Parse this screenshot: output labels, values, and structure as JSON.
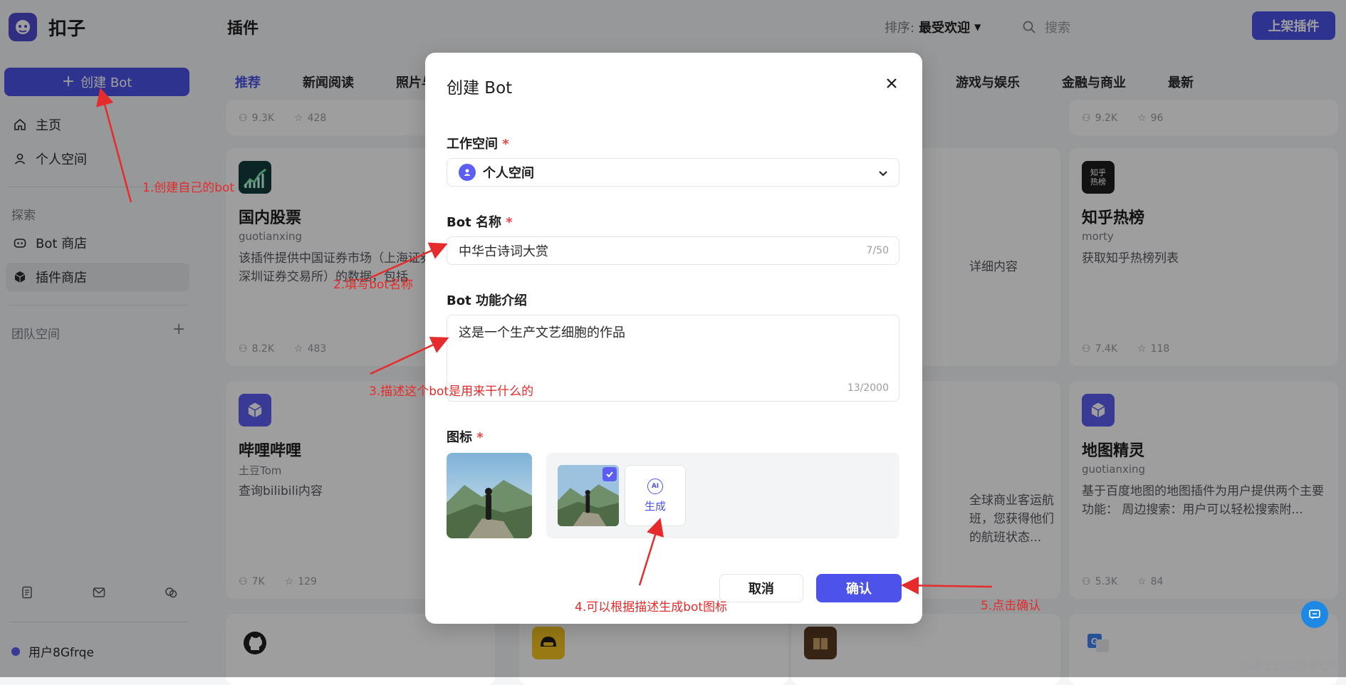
{
  "app": {
    "name": "扣子"
  },
  "sidebar": {
    "create_bot_label": "创建 Bot",
    "items": [
      {
        "label": "主页",
        "icon": "home-icon"
      },
      {
        "label": "个人空间",
        "icon": "user-icon"
      }
    ],
    "explore_label": "探索",
    "explore_items": [
      {
        "label": "Bot 商店",
        "icon": "bot-icon"
      },
      {
        "label": "插件商店",
        "icon": "cube-icon"
      }
    ],
    "team_label": "团队空间",
    "user_name": "用户8Gfrqe"
  },
  "header": {
    "title": "插件",
    "sort_label": "排序:",
    "sort_value": "最受欢迎",
    "search_placeholder": "搜索",
    "publish_label": "上架插件"
  },
  "categories": [
    "推荐",
    "新闻阅读",
    "照片与",
    "游戏与娱乐",
    "金融与商业",
    "最新"
  ],
  "cards": [
    {
      "title": "",
      "author": "",
      "desc": "",
      "uses": "9.3K",
      "stars": "428"
    },
    {
      "title": "",
      "author": "",
      "desc": "",
      "uses": "9.2K",
      "stars": "96"
    },
    {
      "title": "国内股票",
      "author": "guotianxing",
      "desc": "该插件提供中国证券市场（上海证券交易所和深圳证券交易所）的数据，包括",
      "uses": "8.2K",
      "stars": "483"
    },
    {
      "title": "",
      "author": "",
      "desc": "详细内容",
      "uses": "",
      "stars": ""
    },
    {
      "title": "知乎热榜",
      "author": "morty",
      "desc": "获取知乎热榜列表",
      "uses": "7.4K",
      "stars": "118",
      "icon_text": "知乎热榜"
    },
    {
      "title": "哔哩哔哩",
      "author": "土豆Tom",
      "desc": "查询bilibili内容",
      "uses": "7K",
      "stars": "129"
    },
    {
      "title": "",
      "author": "",
      "desc": "全球商业客运航班，您获得他们的航班状态...",
      "uses": "",
      "stars": ""
    },
    {
      "title": "地图精灵",
      "author": "guotianxing",
      "desc": "基于百度地图的地图插件为用户提供两个主要功能： 周边搜索：用户可以轻松搜索附...",
      "uses": "5.3K",
      "stars": "84"
    }
  ],
  "modal": {
    "title": "创建 Bot",
    "workspace_label": "工作空间",
    "workspace_value": "个人空间",
    "name_label": "Bot 名称",
    "name_value": "中华古诗词大赏",
    "name_counter": "7/50",
    "desc_label": "Bot 功能介绍",
    "desc_value": "这是一个生产文艺细胞的作品",
    "desc_counter": "13/2000",
    "icon_label": "图标",
    "generate_label": "生成",
    "ai_badge": "AI",
    "cancel_label": "取消",
    "confirm_label": "确认"
  },
  "annotations": [
    "1.创建自己的bot",
    "2.填写bot名称",
    "3.描述这个bot是用来干什么的",
    "4.可以根据描述生成bot图标",
    "5.点击确认"
  ],
  "watermark": "@稀土掘金技术社区",
  "colors": {
    "accent": "#4d53e8",
    "annotation": "#e52b2b"
  }
}
